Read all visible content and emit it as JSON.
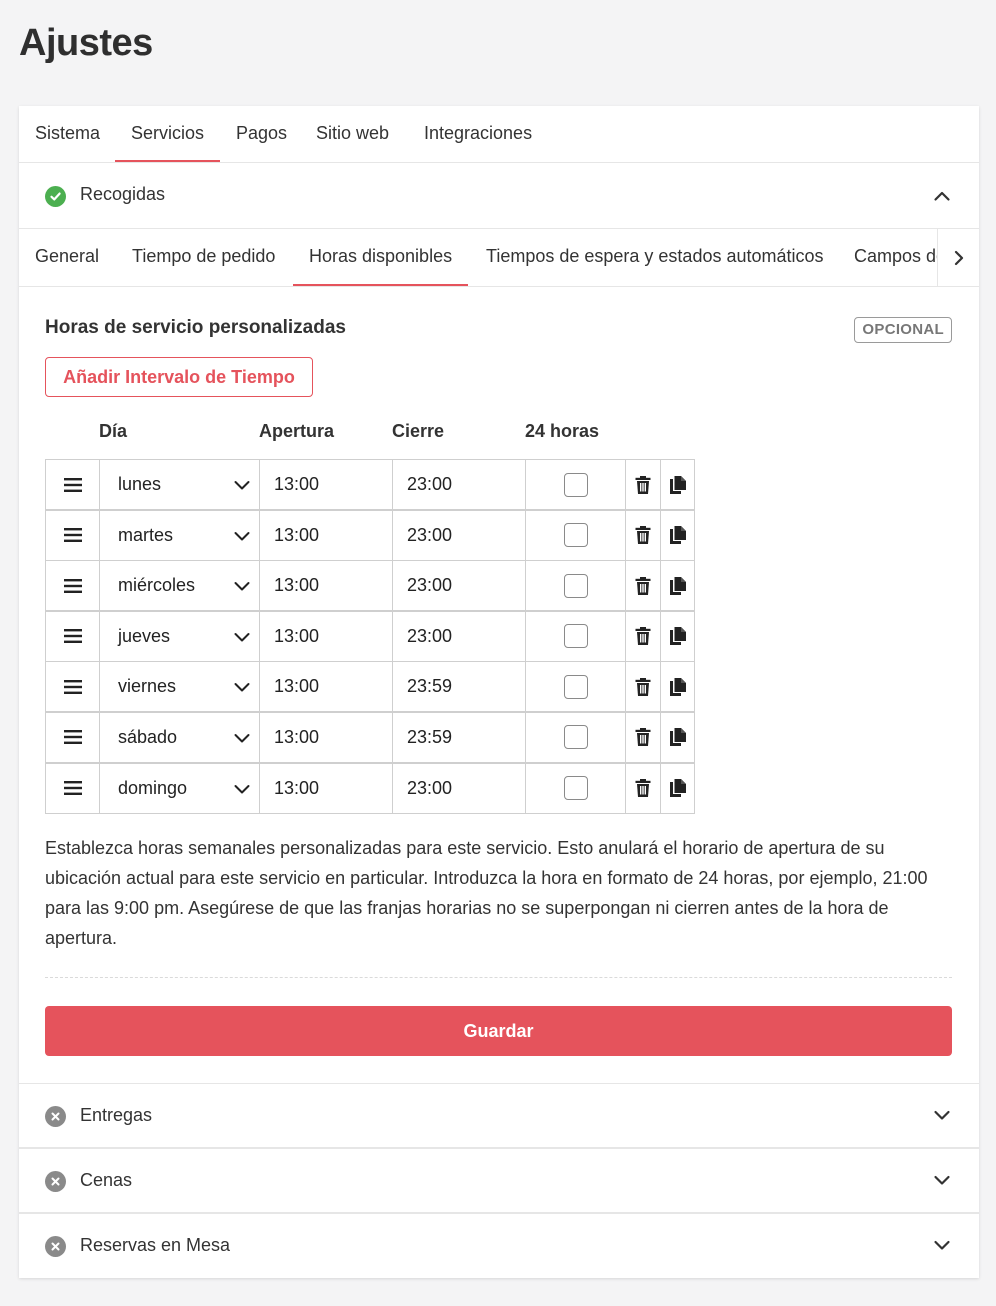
{
  "page": {
    "title": "Ajustes"
  },
  "top_tabs": [
    {
      "label": "Sistema"
    },
    {
      "label": "Servicios"
    },
    {
      "label": "Pagos"
    },
    {
      "label": "Sitio web"
    },
    {
      "label": "Integraciones"
    }
  ],
  "top_tabs_active": "Servicios",
  "sections": {
    "pickup": {
      "label": "Recogidas",
      "status": "enabled",
      "expanded": true
    },
    "delivery": {
      "label": "Entregas",
      "status": "disabled",
      "expanded": false
    },
    "dinein": {
      "label": "Cenas",
      "status": "disabled",
      "expanded": false
    },
    "reservations": {
      "label": "Reservas en Mesa",
      "status": "disabled",
      "expanded": false
    }
  },
  "sub_tabs": [
    {
      "label": "General"
    },
    {
      "label": "Tiempo de pedido"
    },
    {
      "label": "Horas disponibles"
    },
    {
      "label": "Tiempos de espera y estados automáticos"
    },
    {
      "label": "Campos de"
    }
  ],
  "sub_tabs_active": "Horas disponibles",
  "custom_hours": {
    "title": "Horas de servicio personalizadas",
    "badge": "OPCIONAL",
    "add_button": "Añadir Intervalo de Tiempo",
    "columns": {
      "day": "Día",
      "open": "Apertura",
      "close": "Cierre",
      "all_day": "24 horas"
    },
    "rows": [
      {
        "day": "lunes",
        "open": "13:00",
        "close": "23:00",
        "all_day": false
      },
      {
        "day": "martes",
        "open": "13:00",
        "close": "23:00",
        "all_day": false
      },
      {
        "day": "miércoles",
        "open": "13:00",
        "close": "23:00",
        "all_day": false
      },
      {
        "day": "jueves",
        "open": "13:00",
        "close": "23:00",
        "all_day": false
      },
      {
        "day": "viernes",
        "open": "13:00",
        "close": "23:59",
        "all_day": false
      },
      {
        "day": "sábado",
        "open": "13:00",
        "close": "23:59",
        "all_day": false
      },
      {
        "day": "domingo",
        "open": "13:00",
        "close": "23:00",
        "all_day": false
      }
    ],
    "help_text": "Establezca horas semanales personalizadas para este servicio. Esto anulará el horario de apertura de su ubicación actual para este servicio en particular. Introduzca la hora en formato de 24 horas, por ejemplo, 21:00 para las 9:00 pm. Asegúrese de que las franjas horarias no se superpongan ni cierren antes de la hora de apertura.",
    "save_button": "Guardar"
  },
  "colors": {
    "accent": "#e5535c",
    "enabled": "#4caf50",
    "disabled": "#8a8a8a"
  },
  "icons": {
    "drag": "drag-handle-icon",
    "delete": "trash-icon",
    "copy": "copy-icon",
    "chevron_down": "chevron-down-icon",
    "chevron_up": "chevron-up-icon",
    "chevron_right": "chevron-right-icon",
    "enabled": "check-circle-icon",
    "disabled": "x-circle-icon"
  }
}
